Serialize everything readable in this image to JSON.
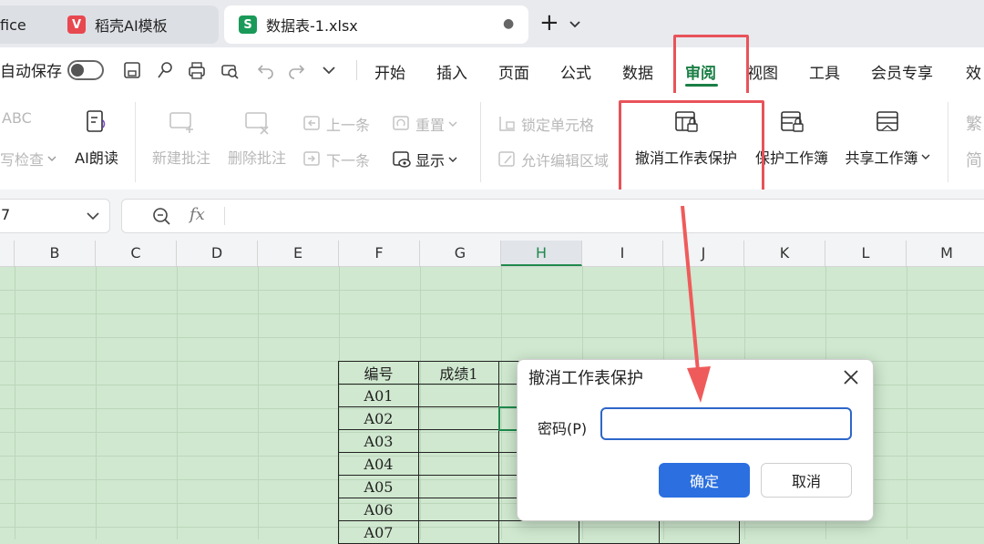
{
  "tabs": [
    {
      "label": "fice",
      "icon": ""
    },
    {
      "label": "稻壳AI模板",
      "icon": "V"
    },
    {
      "label": "数据表-1.xlsx",
      "icon": "S"
    }
  ],
  "tab_add": "+",
  "quickbar": {
    "autosave_label": "自动保存",
    "menus": [
      "开始",
      "插入",
      "页面",
      "公式",
      "数据",
      "审阅",
      "视图",
      "工具",
      "会员专享",
      "效"
    ]
  },
  "ribbon": {
    "spell_check": "写检查",
    "abc": "ABC",
    "ai_read": "AI朗读",
    "new_comment": "新建批注",
    "delete_comment": "删除批注",
    "prev": "上一条",
    "next": "下一条",
    "reset": "重置",
    "show": "显示",
    "lock_cell": "锁定单元格",
    "allow_edit": "允许编辑区域",
    "unprotect_sheet": "撤消工作表保护",
    "protect_book": "保护工作簿",
    "share_book": "共享工作簿",
    "trad": "繁",
    "simp": "简"
  },
  "formula_bar": {
    "name_box": "7",
    "fx": "fx"
  },
  "columns": [
    "B",
    "C",
    "D",
    "E",
    "F",
    "G",
    "H",
    "I",
    "J",
    "K",
    "L",
    "M"
  ],
  "table": {
    "header": [
      "编号",
      "成绩1"
    ],
    "ids": [
      "A01",
      "A02",
      "A03",
      "A04",
      "A05",
      "A06",
      "A07"
    ]
  },
  "dialog": {
    "title": "撤消工作表保护",
    "password_label": "密码(P)",
    "password_value": "",
    "ok": "确定",
    "cancel": "取消"
  },
  "colors": {
    "accent": "#2b6fe0",
    "highlight": "#e8535a",
    "sheet_bg": "#cfe8cf",
    "active_tab_green": "#1f8a4c"
  }
}
